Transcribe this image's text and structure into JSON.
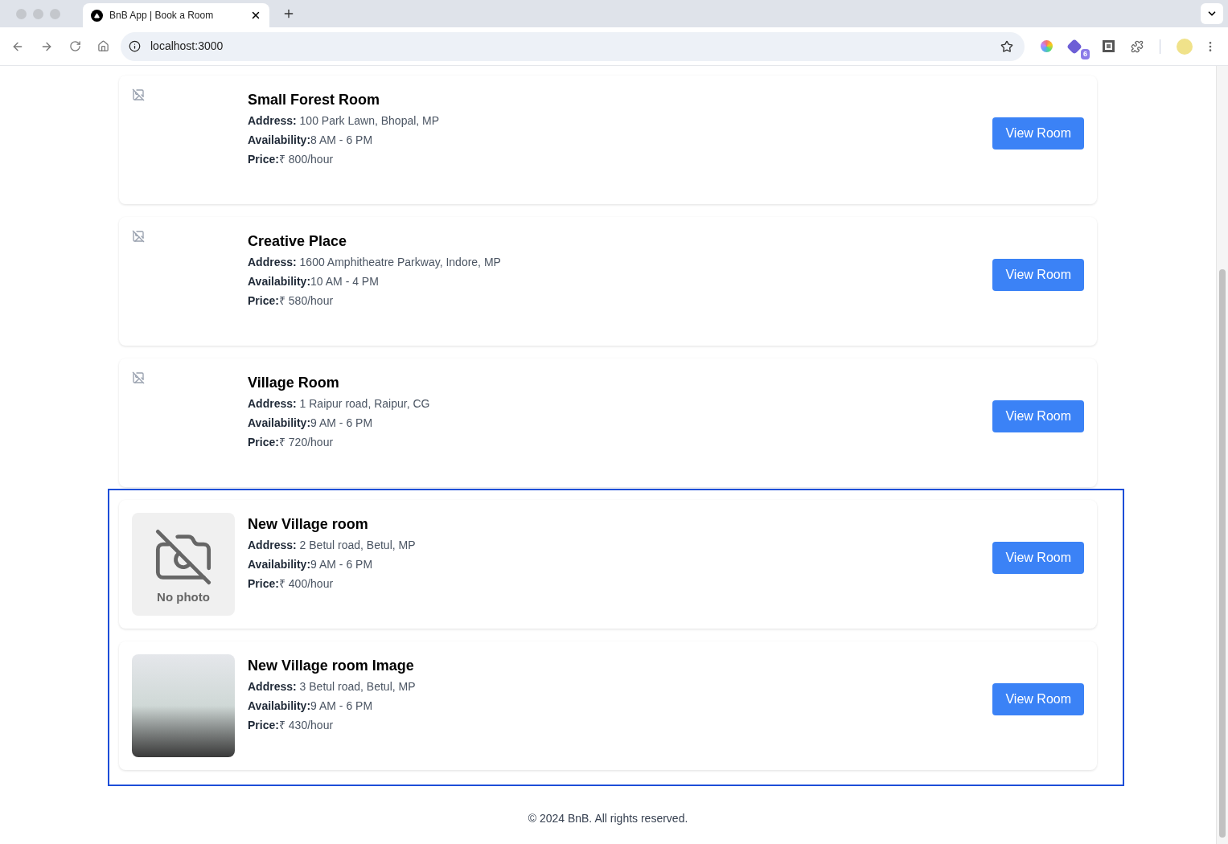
{
  "browser": {
    "tab_title": "BnB App | Book a Room",
    "url": "localhost:3000",
    "extension_badge": "6"
  },
  "room_groups": [
    {
      "outlined": false,
      "rooms": [
        {
          "title": "Small Forest Room",
          "address_label": "Address:",
          "address": "100 Park Lawn, Bhopal, MP",
          "availability_label": "Availability:",
          "availability": "8 AM - 6 PM",
          "price_label": "Price:",
          "price": "₹ 800/hour",
          "image": {
            "kind": "broken"
          },
          "button": "View Room"
        },
        {
          "title": "Creative Place",
          "address_label": "Address:",
          "address": "1600 Amphitheatre Parkway, Indore, MP",
          "availability_label": "Availability:",
          "availability": "10 AM - 4 PM",
          "price_label": "Price:",
          "price": "₹ 580/hour",
          "image": {
            "kind": "broken"
          },
          "button": "View Room"
        },
        {
          "title": "Village Room",
          "address_label": "Address:",
          "address": "1 Raipur road, Raipur, CG",
          "availability_label": "Availability:",
          "availability": "9 AM - 6 PM",
          "price_label": "Price:",
          "price": "₹ 720/hour",
          "image": {
            "kind": "broken"
          },
          "button": "View Room"
        }
      ]
    },
    {
      "outlined": true,
      "rooms": [
        {
          "title": "New Village room",
          "address_label": "Address:",
          "address": "2 Betul road, Betul, MP",
          "availability_label": "Availability:",
          "availability": "9 AM - 6 PM",
          "price_label": "Price:",
          "price": "₹ 400/hour",
          "image": {
            "kind": "no_photo",
            "label": "No photo"
          },
          "button": "View Room"
        },
        {
          "title": "New Village room Image",
          "address_label": "Address:",
          "address": "3 Betul road, Betul, MP",
          "availability_label": "Availability:",
          "availability": "9 AM - 6 PM",
          "price_label": "Price:",
          "price": "₹ 430/hour",
          "image": {
            "kind": "photo"
          },
          "button": "View Room"
        }
      ]
    }
  ],
  "footer": "© 2024 BnB. All rights reserved."
}
